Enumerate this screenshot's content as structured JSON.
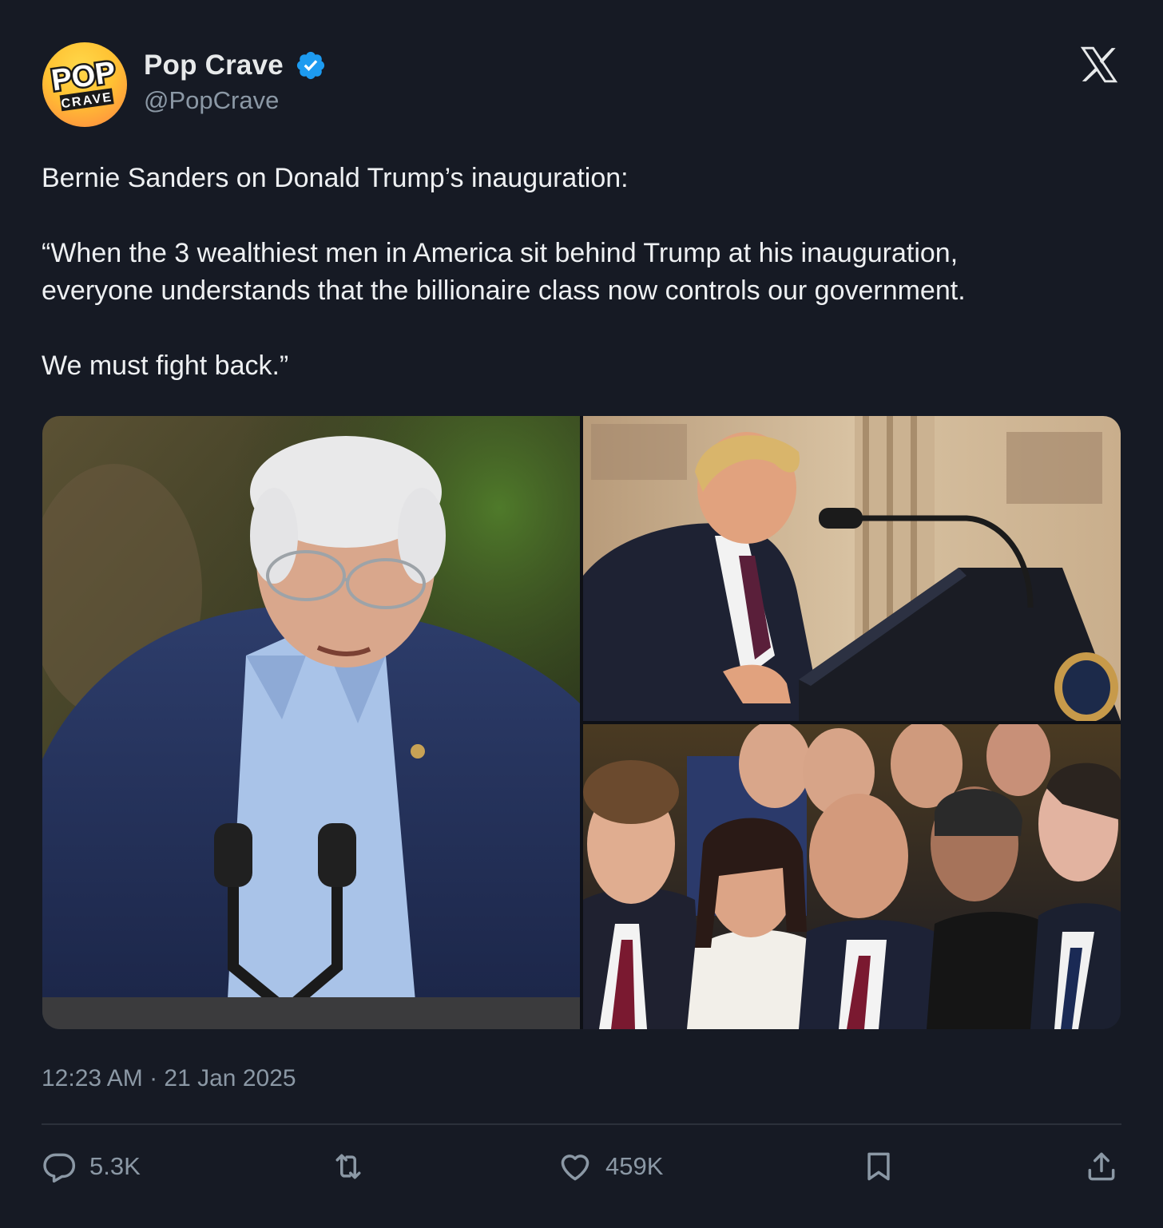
{
  "author": {
    "display_name": "Pop Crave",
    "handle": "@PopCrave",
    "verified": true,
    "avatar": {
      "icon": "pop-crave-logo",
      "line1": "POP",
      "line2": "CRAVE"
    }
  },
  "platform_icon": "x-logo-icon",
  "tweet": {
    "paragraphs": [
      "Bernie Sanders on Donald Trump’s inauguration:",
      "“When the 3 wealthiest men in America sit behind Trump at his inauguration,\neveryone understands that the billionaire class now controls our government.",
      "We must fight back.”"
    ]
  },
  "media": {
    "photo_count": 3
  },
  "timestamp": "12:23 AM · 21 Jan 2025",
  "actions": {
    "reply": {
      "icon": "reply-icon",
      "count": "5.3K"
    },
    "retweet": {
      "icon": "retweet-icon"
    },
    "like": {
      "icon": "heart-icon",
      "count": "459K"
    },
    "bookmark": {
      "icon": "bookmark-icon"
    },
    "share": {
      "icon": "share-icon"
    }
  },
  "colors": {
    "background": "#161a24",
    "text": "#e7e9ea",
    "secondary": "#8b98a5",
    "verified": "#1d9bf0",
    "avatar_yellow": "#ffc233"
  }
}
